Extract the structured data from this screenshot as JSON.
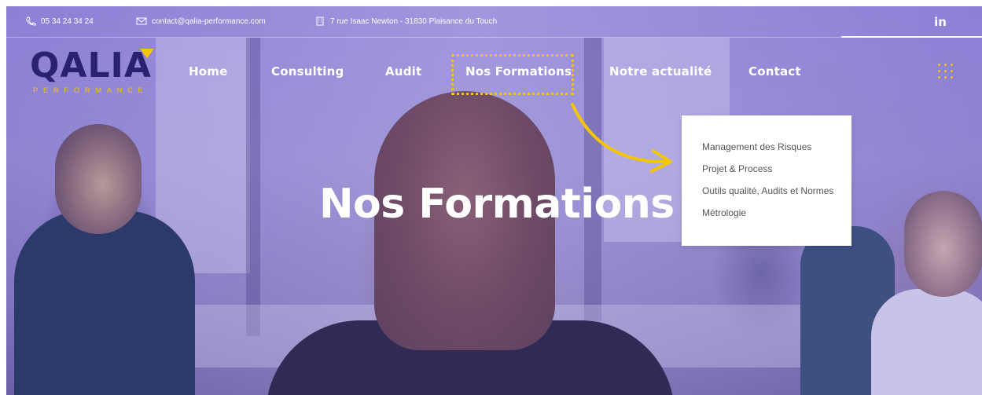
{
  "topbar": {
    "phone": "05 34 24 34 24",
    "email": "contact@qalia-performance.com",
    "address": "7 rue Isaac Newton - 31830 Plaisance du Touch",
    "social": "in"
  },
  "logo": {
    "word": "QALIA",
    "subtitle": "PERFORMANCE"
  },
  "nav": {
    "items": [
      {
        "label": "Home"
      },
      {
        "label": "Consulting"
      },
      {
        "label": "Audit"
      },
      {
        "label": "Nos Formations"
      },
      {
        "label": "Notre actualité"
      },
      {
        "label": "Contact"
      }
    ]
  },
  "dropdown": {
    "items": [
      {
        "label": "Management des Risques"
      },
      {
        "label": "Projet & Process"
      },
      {
        "label": "Outils qualité, Audits et Normes"
      },
      {
        "label": "Métrologie"
      }
    ]
  },
  "hero": {
    "title": "Nos Formations"
  },
  "colors": {
    "accent": "#f4c600",
    "brand": "#2a2270",
    "overlay": "#8d7fd6"
  },
  "icons": {
    "phone": "phone-icon",
    "email": "mail-icon",
    "address": "building-icon",
    "linkedin": "linkedin-icon",
    "menu": "grid-menu-icon"
  }
}
